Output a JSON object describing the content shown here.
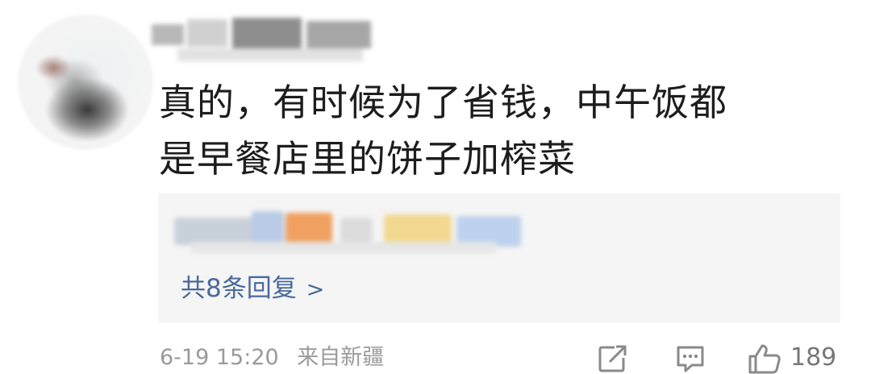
{
  "comment": {
    "text_lines": [
      "真的，有时候为了省钱，中午饭都",
      "是早餐店里的饼子加榨菜"
    ]
  },
  "replies": {
    "count_label": "共8条回复",
    "chevron": ">"
  },
  "footer": {
    "date": "6-19",
    "time": "15:20",
    "location": "来自新疆",
    "like_count": "189"
  },
  "icons": {
    "share": "share-icon",
    "comment": "comment-icon",
    "like": "thumbs-up-icon"
  },
  "colors": {
    "text": "#1d1d1d",
    "reply_link": "#4a6a9a",
    "meta": "#9a9a9a",
    "reply_background": "#f5f5f5"
  }
}
